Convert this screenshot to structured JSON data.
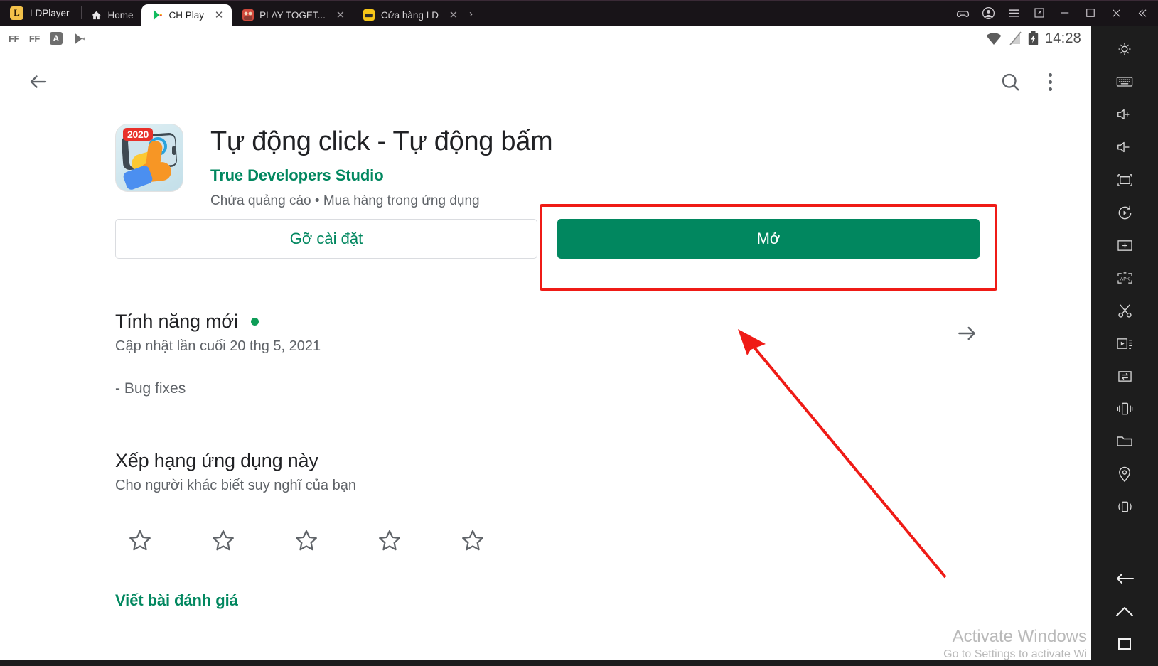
{
  "window": {
    "brand": "LDPlayer",
    "tabs": [
      {
        "label": "Home",
        "icon": "home-icon",
        "closable": false,
        "active": false
      },
      {
        "label": "CH Play",
        "icon": "play-store-icon",
        "closable": true,
        "active": true
      },
      {
        "label": "PLAY TOGET...",
        "icon": "app-icon",
        "closable": true,
        "active": false
      },
      {
        "label": "Cửa hàng LD",
        "icon": "ld-store-icon",
        "closable": true,
        "active": false
      }
    ],
    "tab_overflow": "›",
    "controls": [
      "gamepad-icon",
      "account-icon",
      "menu-icon",
      "resize-icon",
      "minimize-icon",
      "maximize-icon",
      "close-icon",
      "collapse-icon"
    ]
  },
  "status_bar": {
    "left_icons": [
      "ff-badge",
      "ff-badge",
      "a-badge",
      "play-store-icon"
    ],
    "right_icons": [
      "wifi-icon",
      "signal-off-icon",
      "battery-charging-icon"
    ],
    "time": "14:28"
  },
  "action_bar": {
    "back": "back-arrow-icon",
    "search": "search-icon",
    "overflow": "kebab-menu-icon"
  },
  "app": {
    "title": "Tự động click - Tự động bấm",
    "developer": "True Developers Studio",
    "meta_ads": "Chứa quảng cáo",
    "meta_separator": "•",
    "meta_iap": "Mua hàng trong ứng dụng",
    "icon_badge": "2020",
    "buttons": {
      "uninstall": "Gỡ cài đặt",
      "open": "Mở"
    }
  },
  "whats_new": {
    "title": "Tính năng mới",
    "last_updated": "Cập nhật lần cuối 20 thg 5, 2021",
    "body": "- Bug fixes",
    "arrow": "arrow-right-icon"
  },
  "rating": {
    "title": "Xếp hạng ứng dụng này",
    "subtitle": "Cho người khác biết suy nghĩ của bạn",
    "stars": [
      1,
      2,
      3,
      4,
      5
    ],
    "stars_selected": 0,
    "write_review": "Viết bài đánh giá"
  },
  "ld_toolbar": {
    "items": [
      "settings-icon",
      "keyboard-icon",
      "volume-up-icon",
      "volume-down-icon",
      "fullscreen-icon",
      "rotate-icon",
      "add-window-icon",
      "apk-install-icon",
      "scissors-icon",
      "macro-record-icon",
      "sync-icon",
      "shake-icon",
      "folder-icon",
      "location-icon",
      "vibrate-icon"
    ],
    "bottom_items": [
      "back-nav-icon",
      "home-nav-icon",
      "recents-nav-icon"
    ]
  },
  "watermark": {
    "line1": "Activate Windows",
    "line2": "Go to Settings to activate Wi"
  },
  "colors": {
    "accent_green": "#01875f",
    "annotation_red": "#ef1b16",
    "titlebar_bg": "#181418",
    "toolbar_bg": "#1d1d1d"
  }
}
